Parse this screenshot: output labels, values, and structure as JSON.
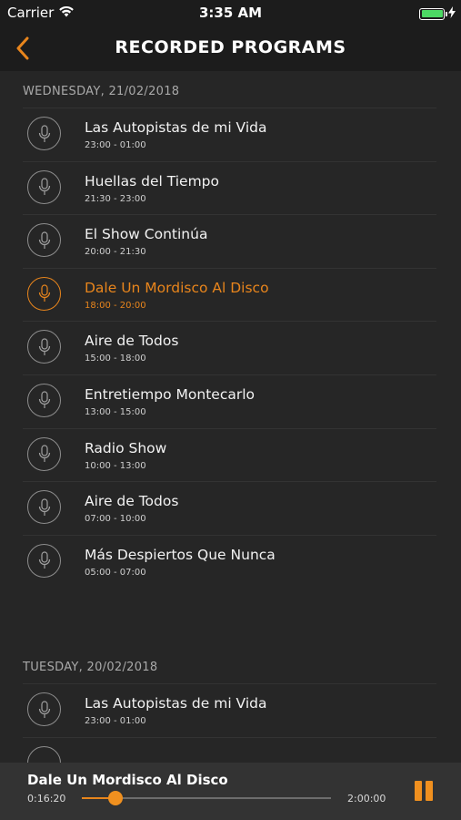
{
  "status_bar": {
    "carrier": "Carrier",
    "time": "3:35 AM"
  },
  "header": {
    "title": "RECORDED PROGRAMS",
    "back_icon": "chevron-left-icon"
  },
  "accent_color": "#E8851C",
  "sections": [
    {
      "date": "WEDNESDAY, 21/02/2018",
      "programs": [
        {
          "title": "Las Autopistas de mi Vida",
          "time": "23:00 - 01:00"
        },
        {
          "title": "Huellas del Tiempo",
          "time": "21:30 - 23:00"
        },
        {
          "title": "El Show Continúa",
          "time": "20:00 - 21:30"
        },
        {
          "title": "Dale Un Mordisco Al Disco",
          "time": "18:00 - 20:00"
        },
        {
          "title": "Aire de Todos",
          "time": "15:00 - 18:00"
        },
        {
          "title": "Entretiempo Montecarlo",
          "time": "13:00 - 15:00"
        },
        {
          "title": "Radio Show",
          "time": "10:00 - 13:00"
        },
        {
          "title": "Aire de Todos",
          "time": "07:00 - 10:00"
        },
        {
          "title": "Más Despiertos Que Nunca",
          "time": "05:00 - 07:00"
        }
      ]
    },
    {
      "date": "TUESDAY, 20/02/2018",
      "programs": [
        {
          "title": "Las Autopistas de mi Vida",
          "time": "23:00 - 01:00"
        }
      ]
    }
  ],
  "player": {
    "title": "Dale Un Mordisco Al Disco",
    "elapsed": "0:16:20",
    "total": "2:00:00",
    "progress_fraction": 0.136,
    "pause_icon": "pause-icon"
  }
}
